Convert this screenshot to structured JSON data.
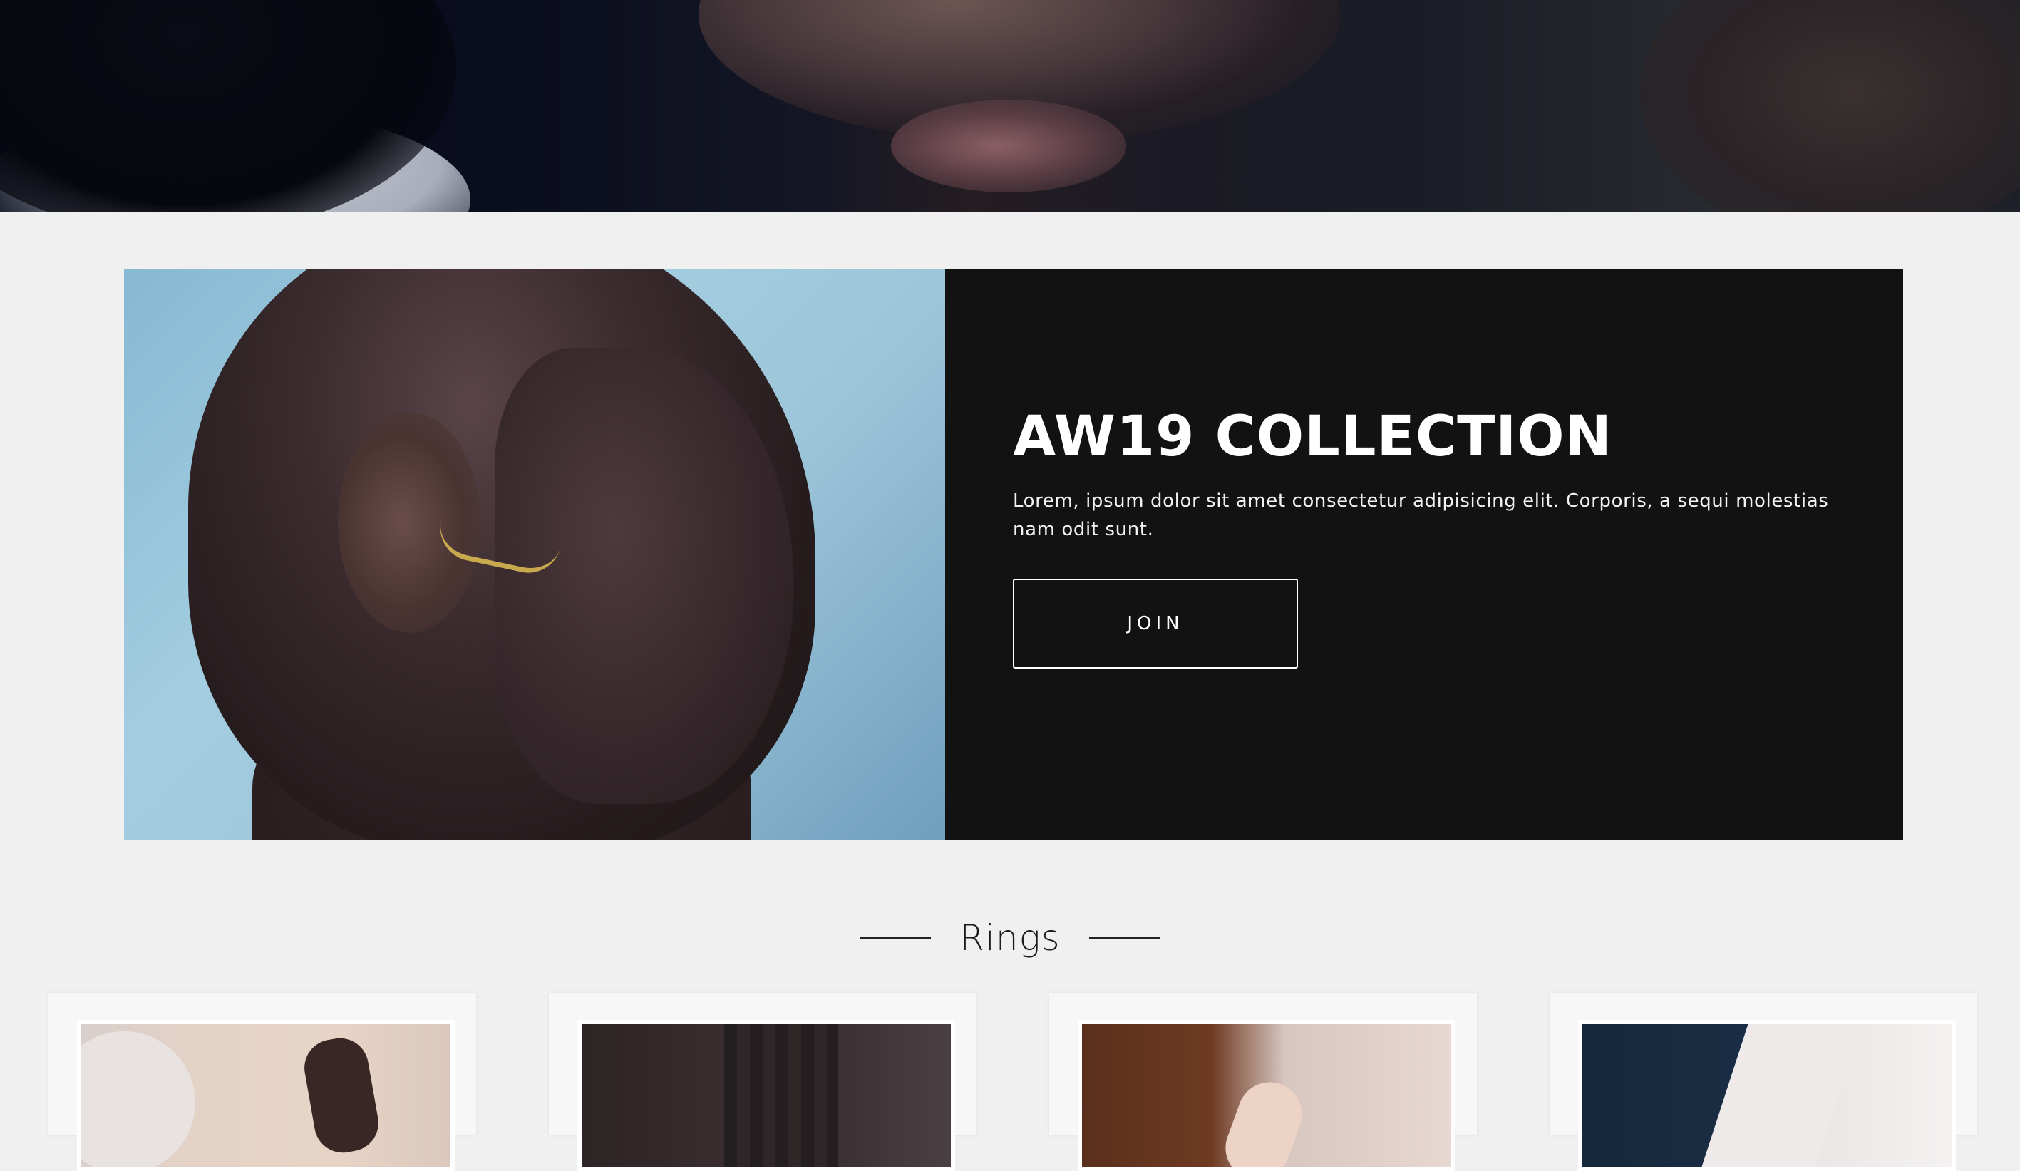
{
  "hero": {
    "image": "portrait-closeup-photo"
  },
  "feature": {
    "image": "profile-portrait-with-gold-ear-cuff-photo",
    "title": "AW19 COLLECTION",
    "text": "Lorem, ipsum dolor sit amet consectetur adipisicing elit. Corporis, a sequi molestias nam odit sunt.",
    "button_label": "JOIN"
  },
  "section": {
    "heading": "Rings"
  },
  "products": [
    {
      "image": "ring-product-photo-1"
    },
    {
      "image": "ring-product-photo-2"
    },
    {
      "image": "ring-product-photo-3"
    },
    {
      "image": "ring-product-photo-4"
    }
  ],
  "colors": {
    "page_background": "#f0f0f0",
    "panel_background": "#121212",
    "accent_gold": "#c9a94e",
    "text_light": "#ffffff",
    "text_dark": "#1b1b1b"
  }
}
